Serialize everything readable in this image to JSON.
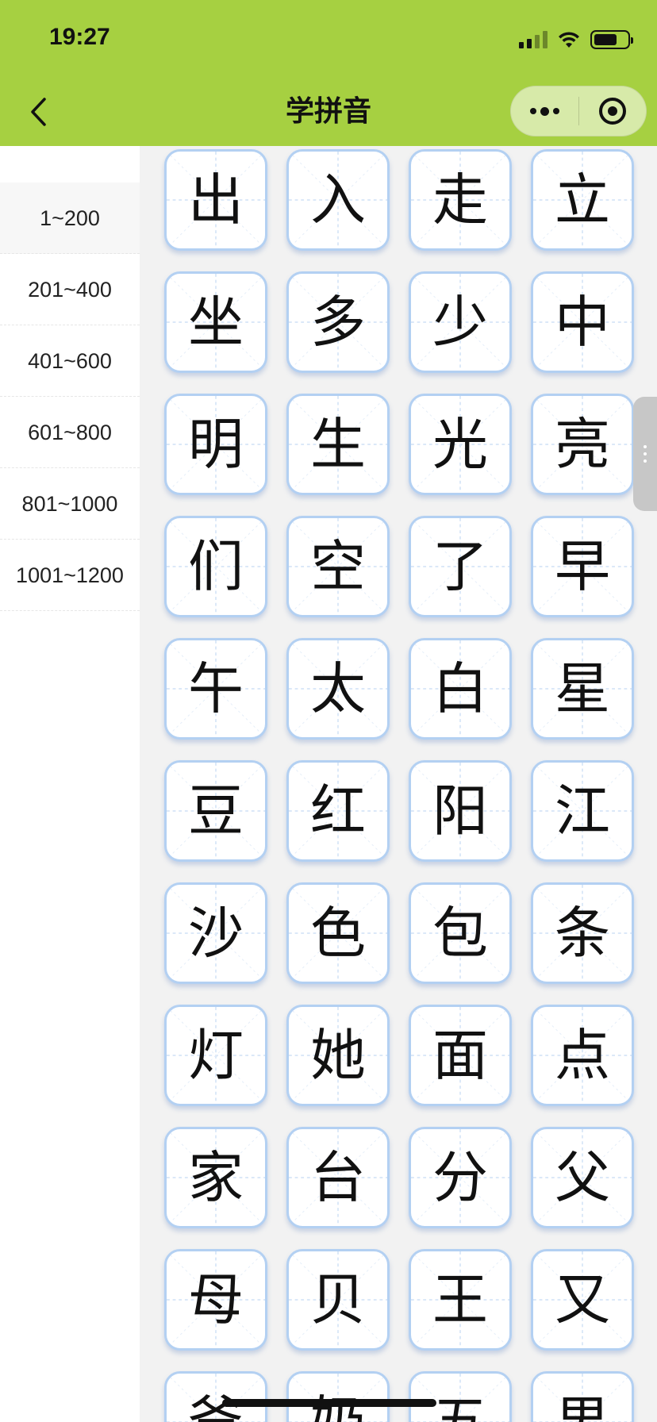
{
  "status_bar": {
    "time": "19:27",
    "icons": [
      "cellular-signal-icon",
      "wifi-icon",
      "battery-icon"
    ]
  },
  "nav": {
    "title": "学拼音",
    "back_icon": "chevron-left-icon",
    "more_icon": "more-dots-icon",
    "close_icon": "target-circle-icon"
  },
  "sidebar": {
    "items": [
      {
        "label": "1~200",
        "active": true
      },
      {
        "label": "201~400",
        "active": false
      },
      {
        "label": "401~600",
        "active": false
      },
      {
        "label": "601~800",
        "active": false
      },
      {
        "label": "801~1000",
        "active": false
      },
      {
        "label": "1001~1200",
        "active": false
      }
    ]
  },
  "characters": [
    "出",
    "入",
    "走",
    "立",
    "坐",
    "多",
    "少",
    "中",
    "明",
    "生",
    "光",
    "亮",
    "们",
    "空",
    "了",
    "早",
    "午",
    "太",
    "白",
    "星",
    "豆",
    "红",
    "阳",
    "江",
    "沙",
    "色",
    "包",
    "条",
    "灯",
    "她",
    "面",
    "点",
    "家",
    "台",
    "分",
    "父",
    "母",
    "贝",
    "王",
    "又",
    "爸",
    "奶",
    "五",
    "男"
  ],
  "colors": {
    "header_bg": "#a6d041",
    "card_border": "#b3d0f2",
    "grid_line": "#cfe0f5",
    "main_bg": "#f2f2f2"
  }
}
